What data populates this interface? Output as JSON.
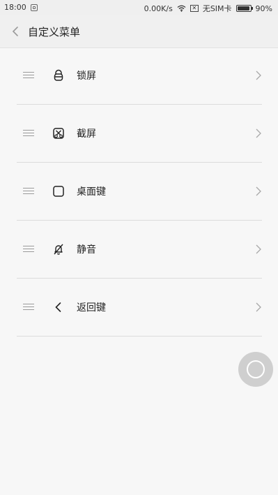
{
  "status": {
    "time": "18:00",
    "speed": "0.00K/s",
    "carrier": "无SIM卡",
    "battery": "90%"
  },
  "header": {
    "title": "自定义菜单"
  },
  "menu_items": [
    {
      "label": "锁屏",
      "icon": "lock-icon"
    },
    {
      "label": "截屏",
      "icon": "screenshot-icon"
    },
    {
      "label": "桌面键",
      "icon": "home-square-icon"
    },
    {
      "label": "静音",
      "icon": "mute-bell-icon"
    },
    {
      "label": "返回键",
      "icon": "back-arrow-icon"
    }
  ],
  "floating_button": {
    "icon": "circle-icon"
  }
}
